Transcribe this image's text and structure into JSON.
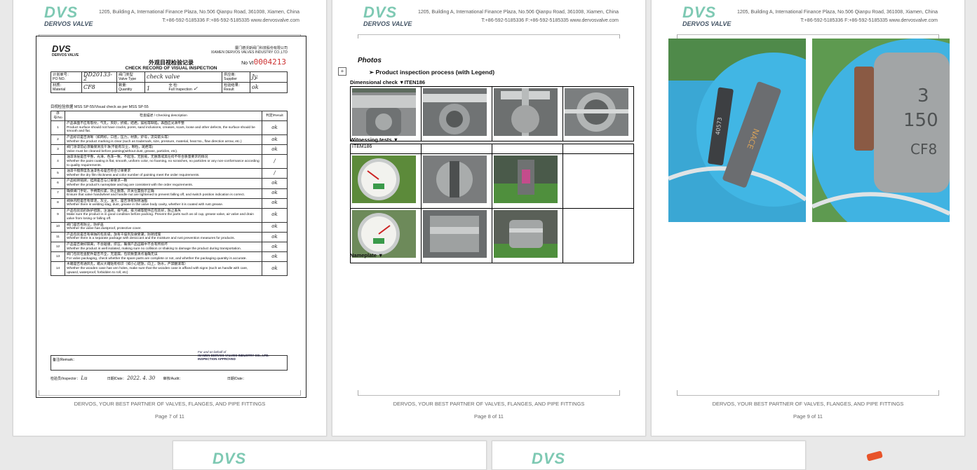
{
  "header": {
    "logo_mark": "DVS",
    "logo_name": "DERVOS VALVE",
    "address": "1205, Building A, International Finance Plaza, No.506 Qianpu Road, 361008, Xiamen, China",
    "contact": "T:+86-592-5185336   F:+86-592-5185335   www.dervosvalve.com"
  },
  "footer": {
    "slogan": "DERVOS, YOUR BEST PARTNER OF VALVES, FLANGES, AND PIPE FITTINGS"
  },
  "pages": [
    {
      "label": "Page 7 of 11"
    },
    {
      "label": "Page 8 of 11"
    },
    {
      "label": "Page 9 of 11"
    }
  ],
  "record": {
    "logo": "DVS",
    "logo_sub": "DERVOS VALVE",
    "company_cn": "厦门德沃斯阀门科技股份有限公司",
    "company_en": "XIAMEN DERVOS VALVES INDUSTRY CO.,LTD",
    "title_cn": "外观目视检验记录",
    "title_en": "CHECK RECORD OF VISUAL INSPECTION",
    "no_label": "No VI",
    "no_value": "0004213",
    "po_label": "计划单号：\nPO NO.",
    "po_value": "DD20133-2",
    "valve_type_label": "阀门类型\nValve Type",
    "valve_type_value": "check valve",
    "supplier_label": "供应商:\nSupplier",
    "supplier_value": "Jy.",
    "material_label": "材质：\nMaterial",
    "material_value": "CF8",
    "quantity_label": "数量:\nQuantity",
    "quantity_value": "1",
    "full_label": "全 检:\nFull Inspection",
    "full_value": "✓",
    "result_label": "检验结果：\nResult",
    "result_value": "ok",
    "standard": "目视检验依据 MSS SP-55/Visual check as per MSS SP-55",
    "col_no": "序号/No",
    "col_desc": "检查描述 / Checking description",
    "col_res": "判定/Result",
    "checks": [
      {
        "no": "1",
        "cn": "产品表面不应有裂纹，气孔，夹砂，折痕，结疤，鼓松等缺陷，表面应光滑平整",
        "en": "Product surface should not have cracks, pores, sand inclusions, creases, scars, loose and other defects, the surface should be smooth and flat.",
        "res": "ok"
      },
      {
        "no": "2",
        "cn": "产品标识是否清晰（如商标，口径，压力，材质，炉号，流向箭头等）",
        "en": "Whether the product marking is clear (such as trademark, size, pressure, material, heat No., flow direction arrow, etc.)",
        "res": "ok"
      },
      {
        "no": "3",
        "cn": "阀门涂漆前必须确保清洗干净(不能有灰尘，颗粒，斑疤等)",
        "en": "Valve must be cleaned before painting(without dust, grease, particles, etc).",
        "res": "ok"
      },
      {
        "no": "4",
        "cn": "油漆涂层是否平整，光滑，色泽一致，不起泡，无刮痕，无脱落或其任何不符合质量要求的情况",
        "en": "Whether the paint coating is flat, smooth, uniform color, no foaming, no scratches, no particles or any non-conformance according to quality requirements.",
        "res": "/"
      },
      {
        "no": "5",
        "cn": "油漆干膜厚度及油漆色号是否符合订单要求",
        "en": "Whether the dry film thickness and color number of painting meet the order requirements.",
        "res": "/"
      },
      {
        "no": "6",
        "cn": "产品标牌铭牌，挂牌是否与订单要求一致",
        "en": "Whether the product's nameplate and tag are consistent with the order requirements.",
        "res": "ok"
      },
      {
        "no": "7",
        "cn": "确保阀门手轮，手柄需拧紧，防止脱落，开关位置指示正确",
        "en": "Ensure that valve handwheel and handle nut are tightened to prevent falling off, and switch position indication is correct.",
        "res": "ok"
      },
      {
        "no": "8",
        "cn": "阀体内腔是否有焊渣，灰尘，油污，是否涂有防锈油脂",
        "en": "Whether there is welding slag, dust, grease in the valve body cavity, whether it is coated with rust grease.",
        "res": "ok"
      },
      {
        "no": "9",
        "cn": "产品包装前的防护措施，注油阀，排气阀，排污阀等配件应包装好，防止丢失",
        "en": "Make sure the product is in good condition before packing. Prevent the parts such as oil cup, grease valve, air valve and drain valve from losing or falling off.",
        "res": "ok"
      },
      {
        "no": "10",
        "cn": "阀门是否有防尘，防护盖",
        "en": "Whether the valve has dustproof, protective cover.",
        "res": "ok"
      },
      {
        "no": "11",
        "cn": "产品包装是否有单独的包装袋，放有干燥剂及做受潮，防锈措施",
        "en": "Whether there is a separate package with desiccant and the moisture and rust prevention measures for products.",
        "res": "ok"
      },
      {
        "no": "12",
        "cn": "产品是否做好隔离，不会碰撞，挤压，确保产品运输中不会有所损坏",
        "en": "Whether the product is well isolated, making sure no collision or shaking to damage the product during transportation.",
        "res": "ok"
      },
      {
        "no": "13",
        "cn": "阀门包装检查配件是否齐全，无遗漏，包装数量清点准确无误",
        "en": "For valve packaging, check whether the spare parts are complete or not, and whether the packaging quantity is accurate.",
        "res": "ok"
      },
      {
        "no": "14",
        "cn": "木箱是否有通风孔，箱从大箱贴有标识（如小心轻放，向上，防水，严禁翻滚等）",
        "en": "Whether the wooden case has ven holes, make sure that the wooden case is affixed with signs (such as handle with care, upward, waterproof, forbidden to roll, etc)",
        "res": "ok"
      }
    ],
    "remark_label": "备注/Remark：",
    "stamp_line1": "For and on behalf of",
    "stamp_line2": "XIAMEN DERVOS VALVES INDUSTRY CO., LTD.",
    "stamp_line3": "INSPECTION APPROVED",
    "inspector_label": "检验员/Inspector：",
    "inspector_value": "Lu",
    "date_label": "日期/Date：",
    "date_value": "2022. 4. 30",
    "audit_label": "审核/Audit：",
    "audit_date_label": "日期/Date："
  },
  "page8": {
    "photos_title": "Photos",
    "anchor": "+",
    "process_label": "➢   Product inspection process (with Legend)",
    "dim_caption": "Dimensional check  ▼ITEN186",
    "witness_caption": "Witnessing tests  ▼",
    "item_label": "ITEM186",
    "nameplate_caption": "Nameplate  ▼"
  },
  "page9": {
    "tag_text": "NACE",
    "tag_numbers": "40573"
  }
}
